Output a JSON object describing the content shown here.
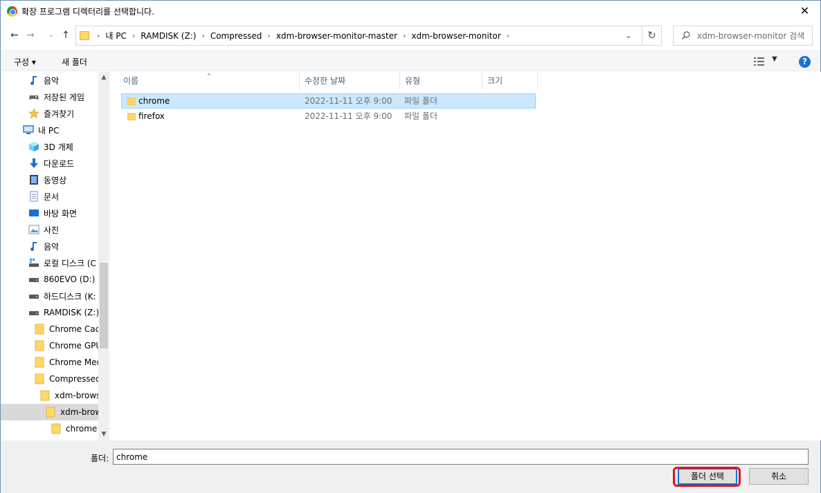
{
  "window": {
    "title": "확장 프로그램 디렉터리를 선택합니다.",
    "close_label": "✕"
  },
  "address": {
    "crumbs": [
      "내 PC",
      "RAMDISK (Z:)",
      "Compressed",
      "xdm-browser-monitor-master",
      "xdm-browser-monitor"
    ],
    "search_placeholder": "xdm-browser-monitor 검색"
  },
  "toolbar": {
    "organize_label": "구성 ▾",
    "new_folder_label": "새 폴더",
    "help_label": "?"
  },
  "nav": {
    "items": [
      {
        "label": "음악",
        "icon": "music-icon"
      },
      {
        "label": "저장된 게임",
        "icon": "game-icon"
      },
      {
        "label": "즐겨찾기",
        "icon": "star-icon"
      },
      {
        "label": "내 PC",
        "icon": "pc-icon"
      },
      {
        "label": "3D 개체",
        "icon": "cube-icon"
      },
      {
        "label": "다운로드",
        "icon": "download-icon"
      },
      {
        "label": "동영상",
        "icon": "video-icon"
      },
      {
        "label": "문서",
        "icon": "document-icon"
      },
      {
        "label": "바탕 화면",
        "icon": "desktop-icon"
      },
      {
        "label": "사진",
        "icon": "picture-icon"
      },
      {
        "label": "음악",
        "icon": "music-icon"
      },
      {
        "label": "로컬 디스크 (C",
        "icon": "drive-c-icon"
      },
      {
        "label": "860EVO (D:)",
        "icon": "drive-icon"
      },
      {
        "label": "하드디스크 (K:",
        "icon": "drive-icon"
      },
      {
        "label": "RAMDISK (Z:)",
        "icon": "drive-icon"
      },
      {
        "label": "Chrome Cach",
        "icon": "folder-icon"
      },
      {
        "label": "Chrome GPU",
        "icon": "folder-icon"
      },
      {
        "label": "Chrome Med",
        "icon": "folder-icon"
      },
      {
        "label": "Compressed",
        "icon": "folder-icon"
      },
      {
        "label": "xdm-browse",
        "icon": "folder-icon"
      },
      {
        "label": "xdm-brow",
        "icon": "folder-icon"
      },
      {
        "label": "chrome",
        "icon": "folder-icon"
      }
    ]
  },
  "columns": {
    "name": "이름",
    "date": "수정한 날짜",
    "type": "유형",
    "size": "크기"
  },
  "files": [
    {
      "name": "chrome",
      "date": "2022-11-11 오후 9:00",
      "type": "파일 폴더",
      "size": ""
    },
    {
      "name": "firefox",
      "date": "2022-11-11 오후 9:00",
      "type": "파일 폴더",
      "size": ""
    }
  ],
  "bottom": {
    "folder_label": "폴더:",
    "folder_value": "chrome",
    "select_button": "폴더 선택",
    "cancel_button": "취소"
  },
  "colors": {
    "selection": "#cce8ff",
    "highlight_ring": "#e0141c",
    "accent": "#0078d7"
  }
}
